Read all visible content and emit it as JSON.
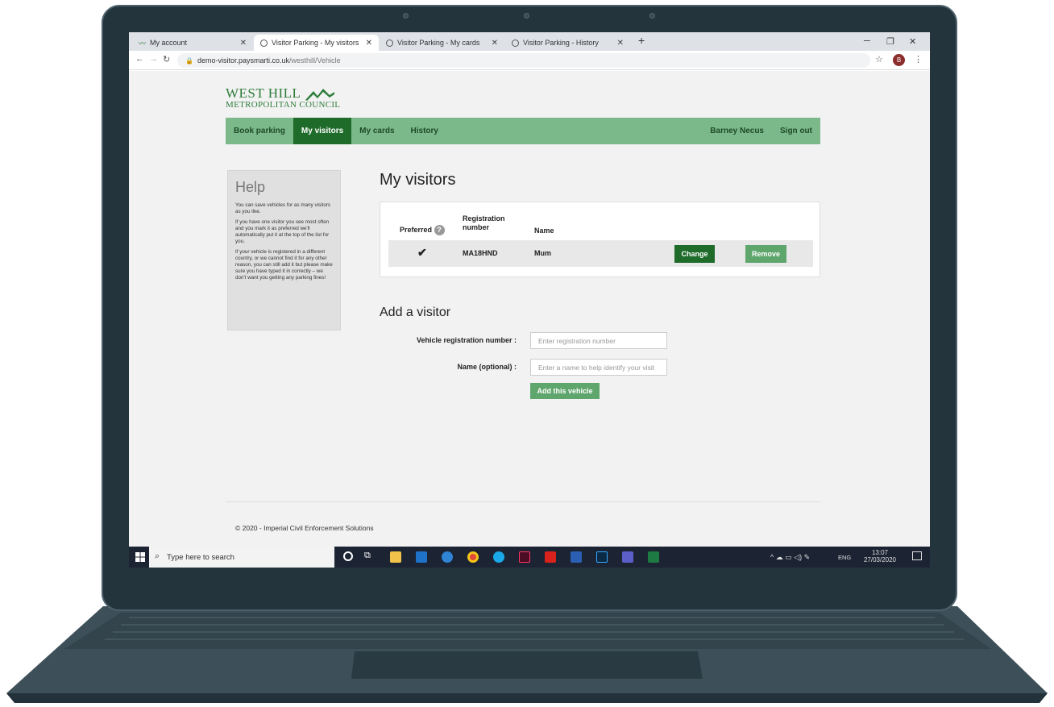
{
  "browser": {
    "tabs": [
      {
        "label": "My account"
      },
      {
        "label": "Visitor Parking - My visitors"
      },
      {
        "label": "Visitor Parking - My cards"
      },
      {
        "label": "Visitor Parking - History"
      }
    ],
    "url_host": "demo-visitor.paysmarti.co.uk",
    "url_path": "/westhill/Vehicle",
    "avatar_letter": "B",
    "new_tab_label": "+"
  },
  "site": {
    "logo_line1": "WEST HILL",
    "logo_line2": "METROPOLITAN COUNCIL",
    "nav": {
      "book_parking": "Book parking",
      "my_visitors": "My visitors",
      "my_cards": "My cards",
      "history": "History",
      "user_name": "Barney Necus",
      "sign_out": "Sign out"
    }
  },
  "help": {
    "title": "Help",
    "paragraphs": [
      "You can save vehicles for as many visitors as you like.",
      "If you have one visitor you see most often and you mark it as preferred we'll automatically put it at the top of the list for you.",
      "If your vehicle is registered in a different country, or we cannot find it for any other reason, you can still add it but please make sure you have typed it in correctly – we don't want you getting any parking fines!"
    ]
  },
  "visitors": {
    "heading": "My visitors",
    "columns": {
      "preferred": "Preferred",
      "registration_line1": "Registration",
      "registration_line2": "number",
      "name": "Name"
    },
    "rows": [
      {
        "preferred_mark": "✔",
        "registration": "MA18HND",
        "name": "Mum",
        "change_label": "Change",
        "remove_label": "Remove"
      }
    ]
  },
  "add_visitor": {
    "heading": "Add a visitor",
    "reg_label": "Vehicle registration number :",
    "reg_placeholder": "Enter registration number",
    "name_label": "Name (optional) :",
    "name_placeholder": "Enter a name to help identify your visit",
    "submit_label": "Add this vehicle"
  },
  "footer": {
    "text": "© 2020 - Imperial Civil Enforcement Solutions"
  },
  "taskbar": {
    "search_placeholder": "Type here to search",
    "language": "ENG",
    "time": "13:07",
    "date": "27/03/2020"
  },
  "colors": {
    "nav_bg": "#7bb98a",
    "nav_active": "#1e6b2a",
    "button_dark": "#1e6b2a",
    "button_light": "#5fa66d",
    "brand_green": "#2e7d3a"
  }
}
